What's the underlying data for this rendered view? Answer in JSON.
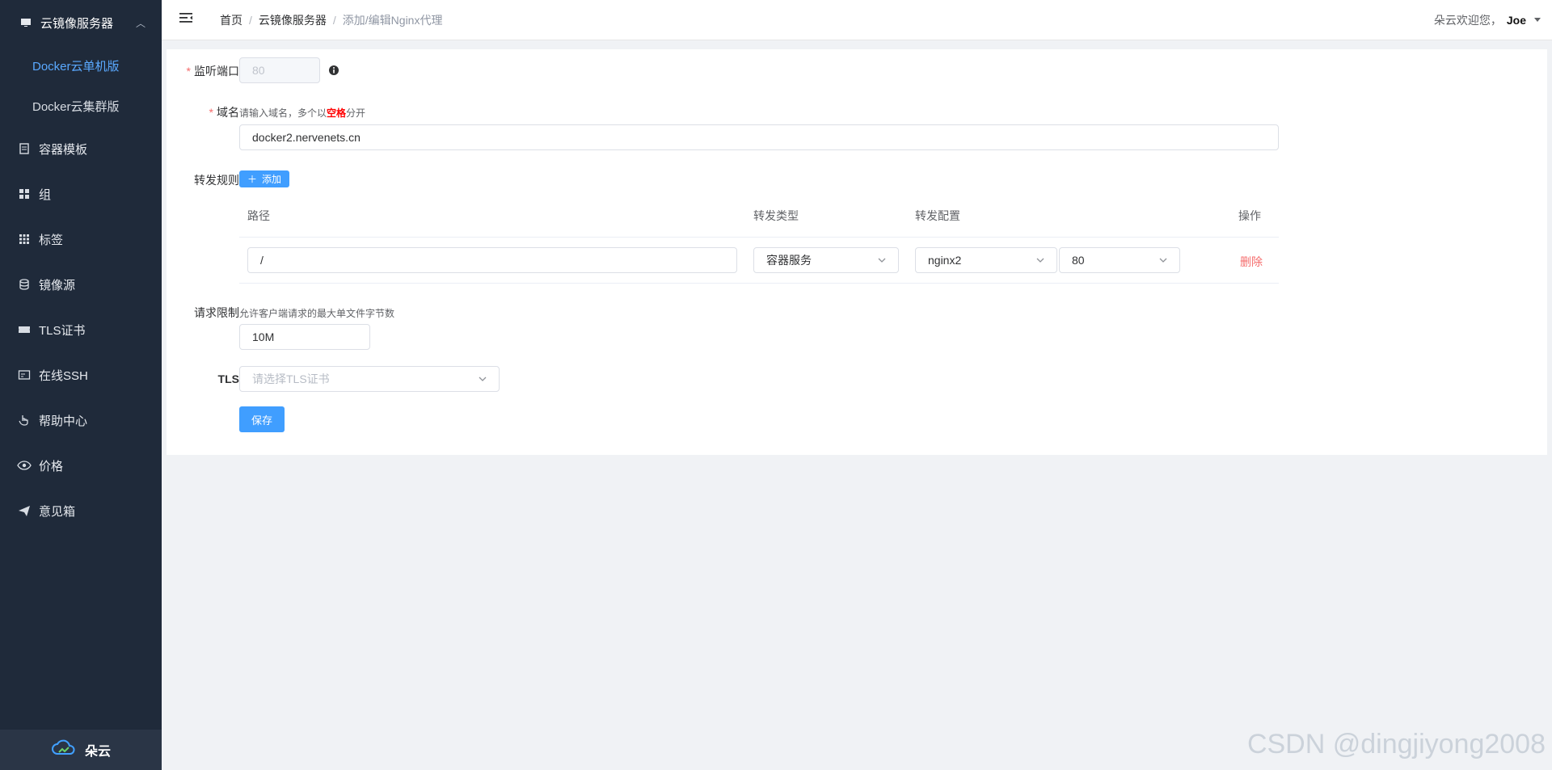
{
  "sidebar": {
    "group_title": "云镜像服务器",
    "subitems": [
      "Docker云单机版",
      "Docker云集群版"
    ],
    "items": [
      "容器模板",
      "组",
      "标签",
      "镜像源",
      "TLS证书",
      "在线SSH",
      "帮助中心",
      "价格",
      "意见箱"
    ],
    "footer_brand": "朵云"
  },
  "header": {
    "breadcrumb": [
      "首页",
      "云镜像服务器",
      "添加/编辑Nginx代理"
    ],
    "user_greeting": "朵云欢迎您，",
    "user_name": "Joe"
  },
  "form": {
    "listen_port": {
      "label": "监听端口",
      "value": "80"
    },
    "domain": {
      "label": "域名",
      "hint_prefix": "请输入域名，多个以",
      "hint_strong": "空格",
      "hint_suffix": "分开",
      "value": "docker2.nervenets.cn"
    },
    "rules": {
      "label": "转发规则",
      "add_button": "添加",
      "columns": [
        "路径",
        "转发类型",
        "转发配置",
        "操作"
      ],
      "row": {
        "path": "/",
        "type": "容器服务",
        "config": "nginx2",
        "port": "80",
        "action": "删除"
      }
    },
    "request_limit": {
      "label": "请求限制",
      "hint": "允许客户端请求的最大单文件字节数",
      "value": "10M"
    },
    "tls": {
      "label": "TLS",
      "placeholder": "请选择TLS证书"
    },
    "save_button": "保存"
  },
  "watermark": "CSDN @dingjiyong2008",
  "colors": {
    "primary": "#409eff",
    "danger": "#f56c6c",
    "sidebar_bg": "#1f2a3a"
  }
}
